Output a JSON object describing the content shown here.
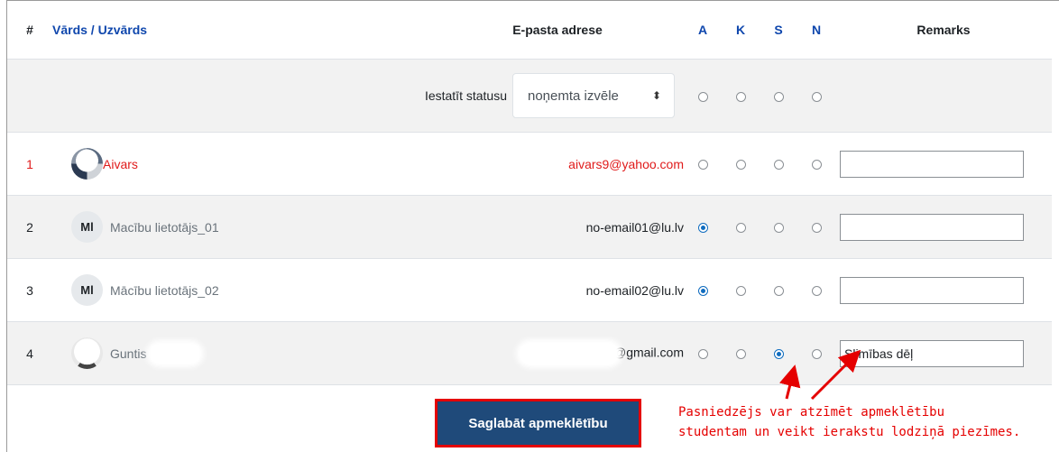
{
  "headers": {
    "num": "#",
    "name": "Vārds / Uzvārds",
    "email": "E-pasta adrese",
    "a": "A",
    "k": "K",
    "s": "S",
    "n": "N",
    "remarks": "Remarks"
  },
  "set_status": {
    "label": "Iestatīt statusu",
    "select_value": "noņemta izvēle",
    "select_arrow": "⬍"
  },
  "rows": [
    {
      "num": "1",
      "avatar": "",
      "name": "Aivars",
      "email": "aivars9@yahoo.com",
      "selected": "",
      "remark": ""
    },
    {
      "num": "2",
      "avatar": "Ml",
      "name": "Macību lietotājs_01",
      "email": "no-email01@lu.lv",
      "selected": "A",
      "remark": ""
    },
    {
      "num": "3",
      "avatar": "Ml",
      "name": "Mācību lietotājs_02",
      "email": "no-email02@lu.lv",
      "selected": "A",
      "remark": ""
    },
    {
      "num": "4",
      "avatar": "",
      "name": "Guntis",
      "email": "@gmail.com",
      "selected": "S",
      "remark": "Slimības dēļ"
    }
  ],
  "save_button": "Saglabāt apmeklētību",
  "annotation": "Pasniedzējs var atzīmēt apmeklētību\nstudentam un veikt ierakstu lodziņā piezīmes.",
  "colors": {
    "accent": "#0f6cbf",
    "button": "#1f4a7a",
    "highlight": "#e50000",
    "name_red": "#e01b1b"
  }
}
